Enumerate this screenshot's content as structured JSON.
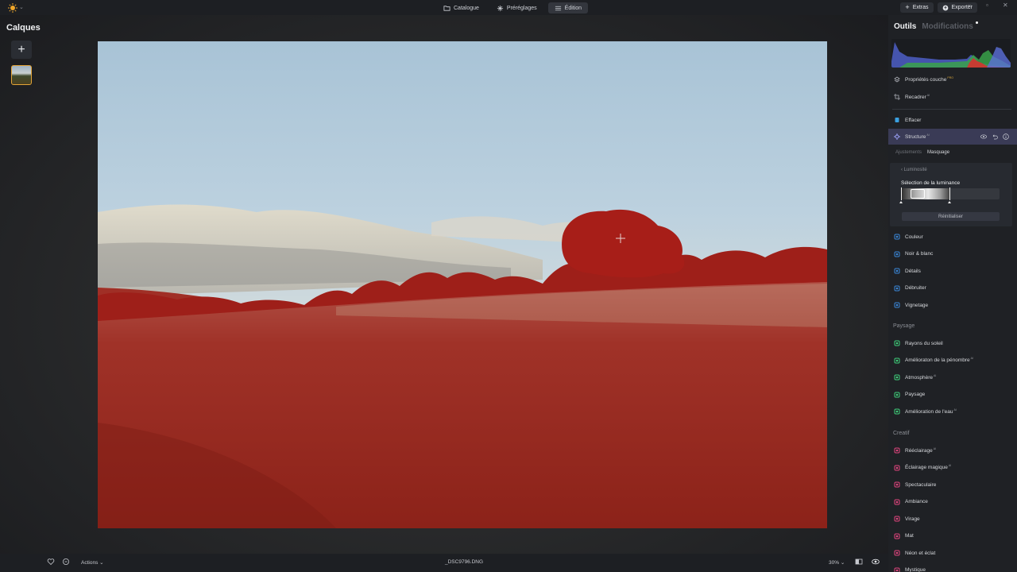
{
  "topbar": {
    "logo_icon": "sun-icon",
    "modes": [
      {
        "label": "Catalogue",
        "icon": "folder-icon",
        "active": false
      },
      {
        "label": "Préréglages",
        "icon": "sparkle-icon",
        "active": false
      },
      {
        "label": "Édition",
        "icon": "sliders-icon",
        "active": true
      }
    ],
    "extras_label": "Extras",
    "export_label": "Exporter"
  },
  "layers": {
    "title": "Calques",
    "add_label": "+"
  },
  "right_panel": {
    "tab_tools": "Outils",
    "tab_modifications": "Modifications",
    "tools_top": [
      {
        "label": "Propriétés couche",
        "tag": "PRO",
        "icon": "layers-icon",
        "color": "#a9acb3"
      },
      {
        "label": "Recadrer",
        "tag": "AI",
        "icon": "crop-icon",
        "color": "#a9acb3"
      }
    ],
    "erase": {
      "label": "Effacer",
      "icon": "eraser-icon",
      "color": "#3aa0e0"
    },
    "structure": {
      "label": "Structure",
      "tag": "AI",
      "icon": "structure-icon",
      "color": "#9fa6ff"
    },
    "subtabs": {
      "adjustments": "Ajustements",
      "masking": "Masquage"
    },
    "mask": {
      "back": "Luminosité",
      "title": "Sélection de la luminance",
      "reset": "Réinitialiser"
    },
    "essentials": [
      {
        "label": "Couleur",
        "tag": "",
        "icon": "color-icon",
        "color": "#3a86d8"
      },
      {
        "label": "Noir & blanc",
        "tag": "",
        "icon": "bw-icon",
        "color": "#3a86d8"
      },
      {
        "label": "Détails",
        "tag": "",
        "icon": "details-icon",
        "color": "#3a86d8"
      },
      {
        "label": "Débruiter",
        "tag": "",
        "icon": "denoise-icon",
        "color": "#3a86d8"
      },
      {
        "label": "Vignetage",
        "tag": "",
        "icon": "vignette-icon",
        "color": "#3a86d8"
      }
    ],
    "landscape_header": "Paysage",
    "landscape": [
      {
        "label": "Rayons du soleil",
        "tag": "",
        "icon": "sunrays-icon",
        "color": "#3fcf7a"
      },
      {
        "label": "Amélioraton de la pénombre",
        "tag": "AI",
        "icon": "dusk-icon",
        "color": "#3fcf7a"
      },
      {
        "label": "Atmosphère",
        "tag": "AI",
        "icon": "atmosphere-icon",
        "color": "#3fcf7a"
      },
      {
        "label": "Paysage",
        "tag": "",
        "icon": "landscape-icon",
        "color": "#3fcf7a"
      },
      {
        "label": "Amélioration de l'eau",
        "tag": "AI",
        "icon": "water-drop-icon",
        "color": "#3fcf7a"
      }
    ],
    "creative_header": "Creatif",
    "creative": [
      {
        "label": "Rééclairage",
        "tag": "AI",
        "icon": "relight-icon",
        "color": "#e0457e"
      },
      {
        "label": "Éclairage magique",
        "tag": "AI",
        "icon": "magic-light-icon",
        "color": "#e0457e"
      },
      {
        "label": "Spectaculaire",
        "tag": "",
        "icon": "dramatic-icon",
        "color": "#e0457e"
      },
      {
        "label": "Ambiance",
        "tag": "",
        "icon": "mood-icon",
        "color": "#e0457e"
      },
      {
        "label": "Virage",
        "tag": "",
        "icon": "toning-icon",
        "color": "#e0457e"
      },
      {
        "label": "Mat",
        "tag": "",
        "icon": "matte-icon",
        "color": "#e0457e"
      },
      {
        "label": "Néon et éclat",
        "tag": "",
        "icon": "neon-icon",
        "color": "#e0457e"
      },
      {
        "label": "Mystique",
        "tag": "",
        "icon": "mystical-icon",
        "color": "#e0457e"
      }
    ]
  },
  "bottombar": {
    "actions_label": "Actions",
    "filename": "_DSC9796.DNG",
    "zoom": "30%"
  }
}
